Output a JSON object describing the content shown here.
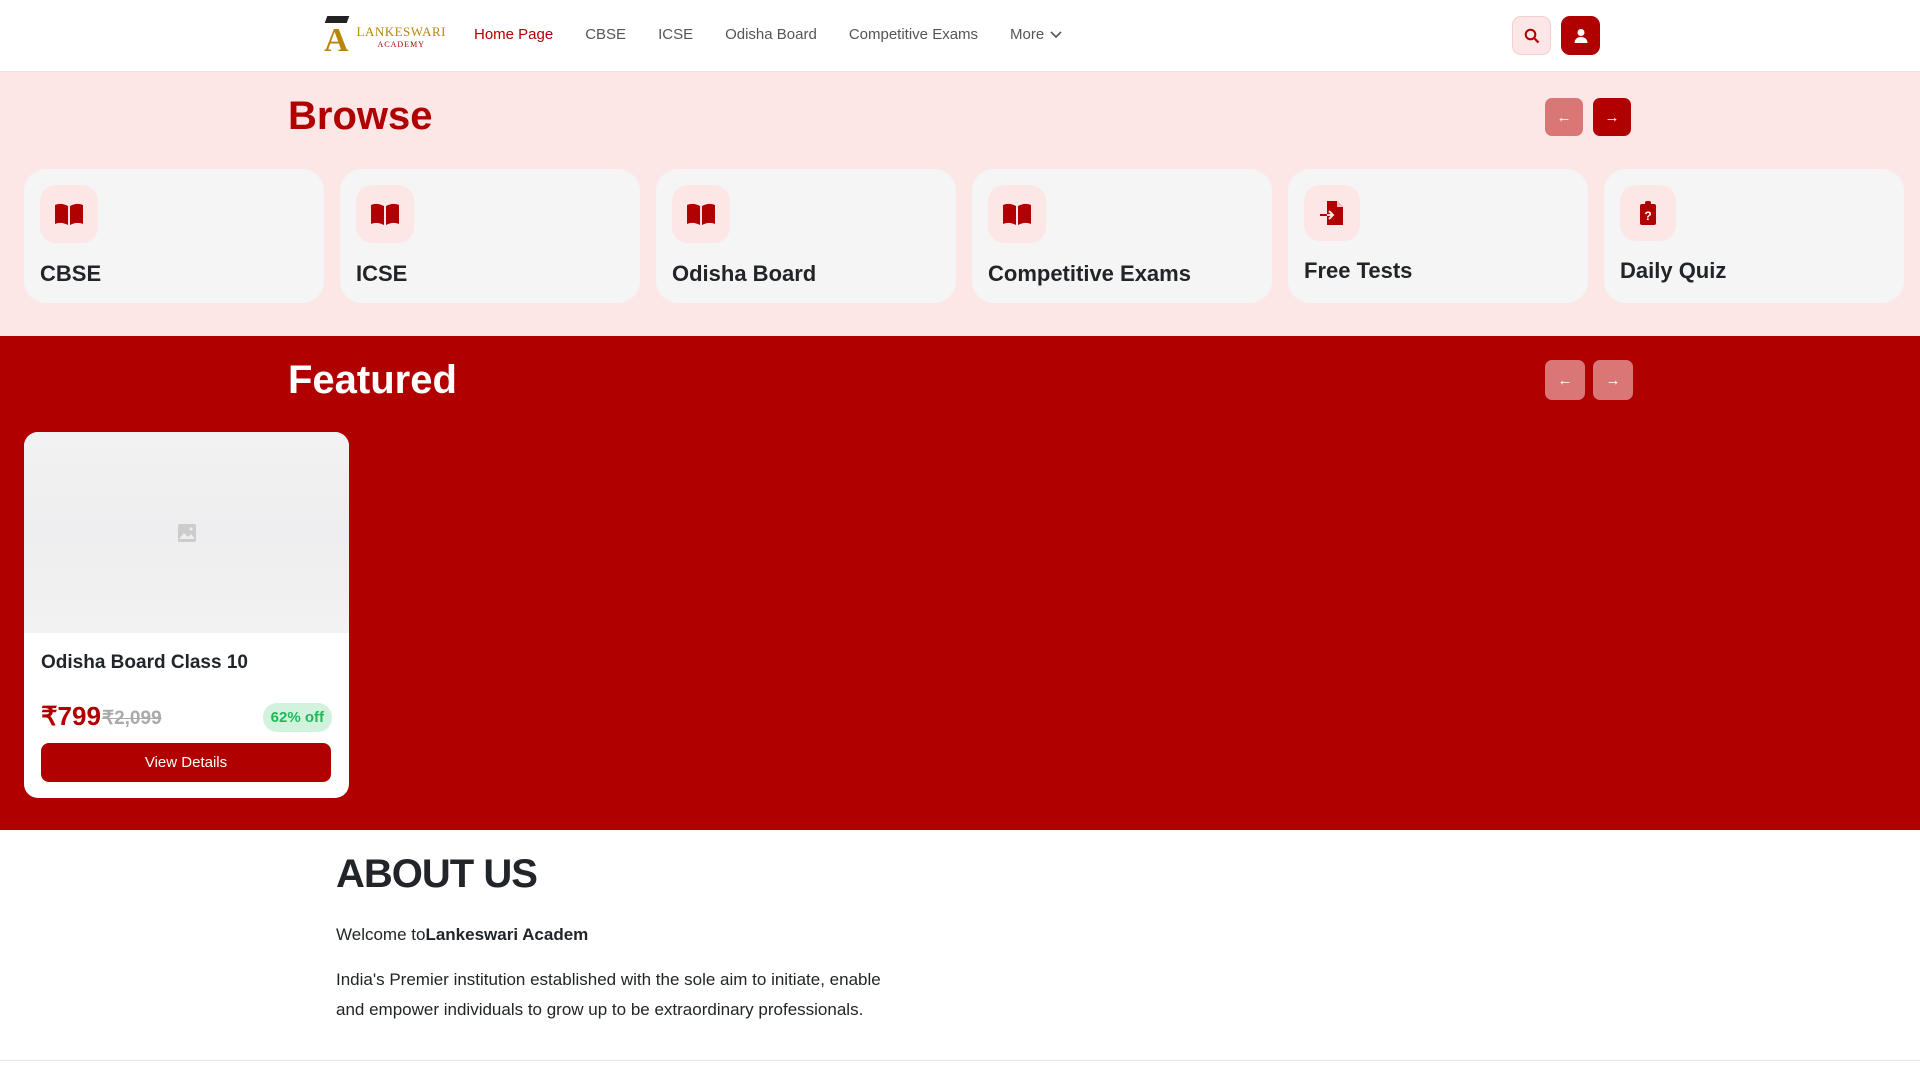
{
  "header": {
    "logo_text": "LANKESWARI",
    "logo_sub": "ACADEMY",
    "menu": [
      {
        "label": "Home Page"
      },
      {
        "label": "CBSE"
      },
      {
        "label": "ICSE"
      },
      {
        "label": "Odisha Board"
      },
      {
        "label": "Competitive Exams"
      },
      {
        "label": "More"
      }
    ]
  },
  "browse": {
    "title": "Browse",
    "prev": "←",
    "next": "→",
    "items": [
      {
        "label": "CBSE",
        "icon": "book-open-icon"
      },
      {
        "label": "ICSE",
        "icon": "book-open-icon"
      },
      {
        "label": "Odisha Board",
        "icon": "book-open-icon"
      },
      {
        "label": "Competitive Exams",
        "icon": "book-open-icon"
      },
      {
        "label": "Free Tests",
        "icon": "file-import-icon"
      },
      {
        "label": "Daily Quiz",
        "icon": "clipboard-question-icon"
      }
    ]
  },
  "featured": {
    "title": "Featured",
    "prev": "←",
    "next": "→",
    "course": {
      "title": "Odisha Board Class 10",
      "price": "₹799",
      "original_price": "₹2,099",
      "discount": "62% off",
      "button": "View Details"
    }
  },
  "about": {
    "title": "ABOUT US",
    "welcome": "Welcome to",
    "brand": "Lankeswari Academ",
    "description": "India's Premier institution established with the sole aim to initiate, enable and empower individuals to grow up to be extraordinary professionals."
  },
  "colors": {
    "brand": "#b00000",
    "browse_bg": "#fde6e6"
  }
}
